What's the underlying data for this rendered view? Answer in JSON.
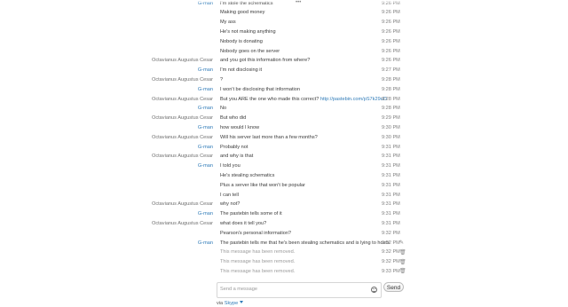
{
  "conversation": {
    "rows": [
      {
        "sender": "G-man",
        "kind": "gm",
        "text": "I'm stole the schematics",
        "time": "9:26 PM"
      },
      {
        "sender": "",
        "kind": "",
        "text": "Making good money",
        "time": "9:26 PM"
      },
      {
        "sender": "",
        "kind": "",
        "text": "My ass",
        "time": "9:26 PM"
      },
      {
        "sender": "",
        "kind": "",
        "text": "He's not making anything",
        "time": "9:26 PM"
      },
      {
        "sender": "",
        "kind": "",
        "text": "Nobody is donating",
        "time": "9:26 PM"
      },
      {
        "sender": "",
        "kind": "",
        "text": "Nobody goes on the server",
        "time": "9:26 PM"
      },
      {
        "sender": "Octavianus Augustus Cesar",
        "kind": "oc",
        "text": "and you got this information from where?",
        "time": "9:26 PM"
      },
      {
        "sender": "G-man",
        "kind": "gm",
        "text": "I'm not disclosing it",
        "time": "9:27 PM"
      },
      {
        "sender": "Octavianus Augustus Cesar",
        "kind": "oc",
        "text": "?",
        "time": "9:28 PM"
      },
      {
        "sender": "G-man",
        "kind": "gm",
        "text": "I won't be disclosing that information",
        "time": "9:28 PM"
      },
      {
        "sender": "Octavianus Augustus Cesar",
        "kind": "oc",
        "text": "But you ARE the one who made this correct?",
        "link": "http://pastebin.com/pS7k29uD",
        "time": "9:28 PM"
      },
      {
        "sender": "G-man",
        "kind": "gm",
        "text": "No",
        "time": "9:28 PM"
      },
      {
        "sender": "Octavianus Augustus Cesar",
        "kind": "oc",
        "text": "But who did",
        "time": "9:29 PM"
      },
      {
        "sender": "G-man",
        "kind": "gm",
        "text": "how would I know",
        "time": "9:30 PM"
      },
      {
        "sender": "Octavianus Augustus Cesar",
        "kind": "oc",
        "text": "Will his server last more than a few months?",
        "time": "9:30 PM"
      },
      {
        "sender": "G-man",
        "kind": "gm",
        "text": "Probably not",
        "time": "9:31 PM"
      },
      {
        "sender": "Octavianus Augustus Cesar",
        "kind": "oc",
        "text": "and why is that",
        "time": "9:31 PM"
      },
      {
        "sender": "G-man",
        "kind": "gm",
        "text": "I told you",
        "time": "9:31 PM"
      },
      {
        "sender": "",
        "kind": "",
        "text": "He's stealing schematics",
        "time": "9:31 PM"
      },
      {
        "sender": "",
        "kind": "",
        "text": "Plus a server like that won't be popular",
        "time": "9:31 PM"
      },
      {
        "sender": "",
        "kind": "",
        "text": "I can tell",
        "time": "9:31 PM"
      },
      {
        "sender": "Octavianus Augustus Cesar",
        "kind": "oc",
        "text": "why not?",
        "time": "9:31 PM"
      },
      {
        "sender": "G-man",
        "kind": "gm",
        "text": "The pastebin tells some of it",
        "time": "9:31 PM"
      },
      {
        "sender": "Octavianus Augustus Cesar",
        "kind": "oc",
        "text": "what does it tell you?",
        "time": "9:31 PM"
      },
      {
        "sender": "",
        "kind": "",
        "text": "Pearson's personal information?",
        "time": "9:32 PM"
      },
      {
        "sender": "G-man",
        "kind": "gm",
        "text": "The pastebin tells me that he's been stealing schematics and is lying to hosts",
        "time": "9:32 PM",
        "status": "✎"
      },
      {
        "sender": "",
        "kind": "",
        "text": "This message has been removed.",
        "removed": true,
        "time": "9:32 PM",
        "status": "🗑"
      },
      {
        "sender": "",
        "kind": "",
        "text": "This message has been removed.",
        "removed": true,
        "time": "9:32 PM",
        "status": "🗑"
      },
      {
        "sender": "",
        "kind": "",
        "text": "This message has been removed.",
        "removed": true,
        "time": "9:33 PM",
        "status": "🗑"
      }
    ]
  },
  "composer": {
    "placeholder": "Send a message",
    "emoji_icon": "smiley-icon",
    "send_label": "Send"
  },
  "footer": {
    "via_label": "via",
    "service_label": "Skype",
    "service_color": "#2f7bb8"
  },
  "scroll_indicator": "•••"
}
